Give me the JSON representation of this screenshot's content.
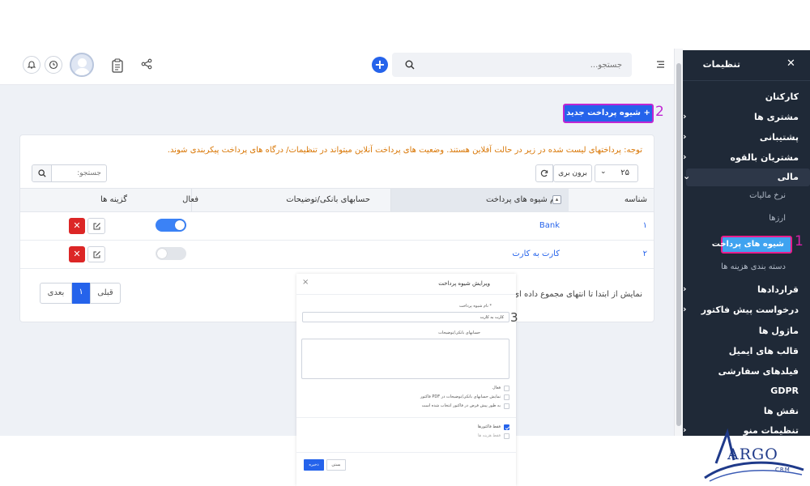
{
  "topbar": {
    "search_placeholder": "جستجو...",
    "add_label": "+"
  },
  "sidebar": {
    "title": "تنظیمات",
    "close": "✕",
    "items": [
      {
        "label": "کارکنان"
      },
      {
        "label": "مشتری ها"
      },
      {
        "label": "پشتیبانی"
      },
      {
        "label": "مشتریان بالقوه"
      },
      {
        "label": "مالی"
      },
      {
        "label": "قراردادها"
      },
      {
        "label": "درخواست پیش فاکتور"
      },
      {
        "label": "ماژول ها"
      },
      {
        "label": "قالب های ایمیل"
      },
      {
        "label": "فیلدهای سفارشی"
      },
      {
        "label": "GDPR"
      },
      {
        "label": "نقش ها"
      },
      {
        "label": "تنظیمات منو"
      }
    ],
    "sub_items": [
      {
        "label": "نرخ مالیات"
      },
      {
        "label": "ارزها"
      },
      {
        "label": "شیوه های پرداخت"
      },
      {
        "label": "دسته بندی هزینه ها"
      }
    ],
    "marker": "1"
  },
  "page": {
    "new_button": "+ شیوه پرداخت جدید",
    "marker": "2",
    "notice": "توجه: پرداختهای لیست شده در زیر در حالت آفلاین هستند. وضعیت های پرداخت آنلاین میتواند در تنظیمات/ درگاه های پرداخت پیکربندی شوند.",
    "per_page": "۲۵",
    "export_label": "برون بری",
    "search_placeholder": "جستجو:",
    "columns": [
      "شناسه",
      "نام شیوه های پرداخت",
      "حسابهای بانکی/توضیحات",
      "فعال",
      "گزینه ها"
    ],
    "rows": [
      {
        "id": "۱",
        "name": "Bank",
        "active": true
      },
      {
        "id": "۲",
        "name": "کارت به کارت",
        "active": false
      }
    ],
    "showing": "نمایش از ابتدا تا انتهای مجموع داده ای",
    "pagination": {
      "prev": "قبلی",
      "current": "۱",
      "next": "بعدی"
    }
  },
  "modal": {
    "title": "ویرایش شیوه پرداخت",
    "close": "×",
    "name_label": "* نام شیوه پرداخت",
    "name_value": "کارت به کارت",
    "marker": "3",
    "desc_label": "حسابهای بانکی/توضیحات",
    "checks": [
      {
        "label": "فعال",
        "checked": false
      },
      {
        "label": "نمایش حسابهای بانکی/توضیحات در PDF فاکتور",
        "checked": false
      },
      {
        "label": "به طور پیش فرض در فاکتور انتخاب شده است",
        "checked": false
      },
      {
        "label": "فقط فاکتورها",
        "checked": true
      },
      {
        "label": "فقط هزینه ها",
        "checked": false
      }
    ],
    "save": "ذخیره",
    "close_btn": "بستن"
  },
  "logo": {
    "text": "ARGO",
    "sub": "CRM"
  },
  "colors": {
    "accent": "#2563eb",
    "sidebar": "#1f2937",
    "active": "#3fa3f0",
    "marker": "#c026d3",
    "danger": "#dc2626",
    "notice": "#d97706"
  }
}
